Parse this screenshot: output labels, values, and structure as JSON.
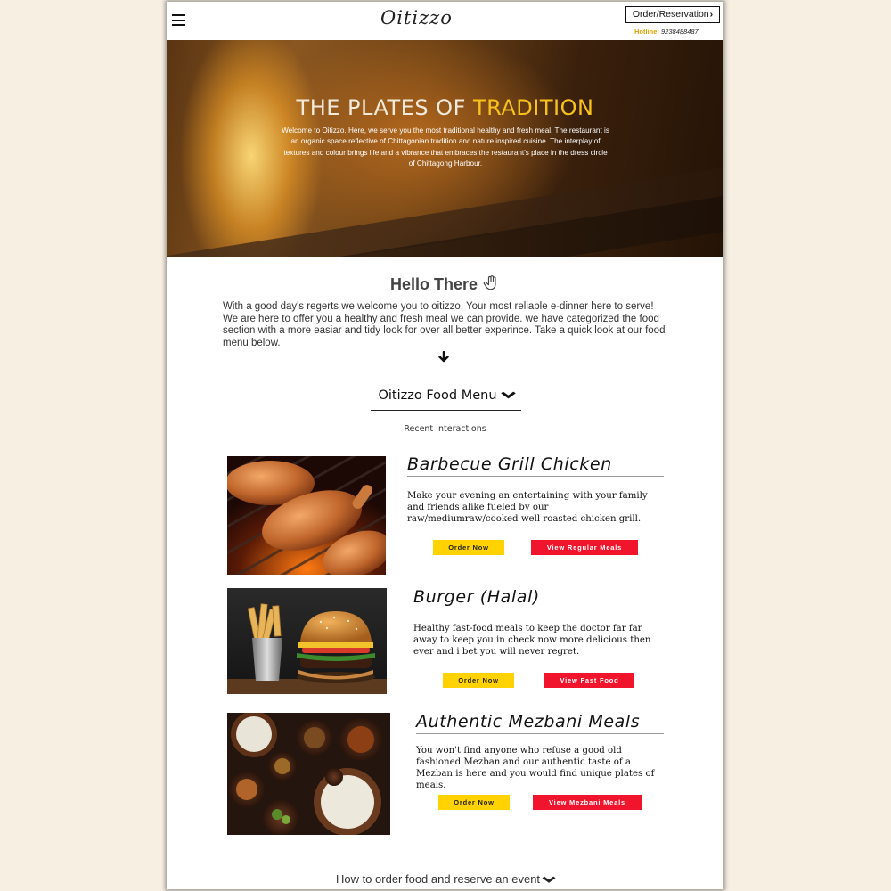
{
  "header": {
    "logo": "Oitizzo",
    "order_button": "Order/Reservation",
    "hotline_label": "Hotline:",
    "hotline_number": "9238488487"
  },
  "hero": {
    "title_main": "THE PLATES OF ",
    "title_accent": "TRADITION",
    "text": "Welcome to Oitizzo. Here, we serve you the most traditional healthy and fresh meal. The restaurant is an organic space reflective of Chittagonian tradition and nature inspired cuisine. The interplay of textures and colour brings life and a vibrance that embraces the restaurant's place in the dress circle of Chittagong Harbour."
  },
  "hello": {
    "title": "Hello There",
    "text": "With a good day's regerts we welcome you to oitizzo, Your most reliable e-dinner here to serve! We are here to offer you a healthy and fresh meal we can provide. we have categorized the food section with a more easiar and tidy look for over all better experince. Take a quick look at our food menu below."
  },
  "menu": {
    "heading": "Oitizzo Food Menu",
    "subheading": "Recent Interactions",
    "items": [
      {
        "title": "Barbecue Grill Chicken",
        "description": "Make your evening an entertaining with your family and friends alike fueled by our raw/mediumraw/cooked well roasted chicken grill.",
        "order_label": "Order Now",
        "view_label": "View Regular Meals"
      },
      {
        "title": "Burger (Halal)",
        "description": "Healthy fast-food meals to keep the doctor far far away to keep you in check now more delicious then ever and i bet you will never regret.",
        "order_label": "Order Now",
        "view_label": "View Fast Food"
      },
      {
        "title": "Authentic Mezbani Meals",
        "description": "You won't find anyone who refuse a good old fashioned Mezban and our authentic taste of a Mezban is here and you would find unique plates of meals.",
        "order_label": "Order Now",
        "view_label": "View Mezbani Meals"
      }
    ]
  },
  "footer": {
    "link": "How to order food and reserve an event"
  },
  "colors": {
    "accent_yellow": "#ffd200",
    "accent_red": "#f0142c",
    "title_gold": "#f7c21c",
    "page_bg": "#f6efe2"
  },
  "icons": {
    "menu": "hamburger-icon",
    "hand": "hand-icon",
    "arrow_down": "arrow-down-icon",
    "chevron": "chevron-down-icon"
  }
}
